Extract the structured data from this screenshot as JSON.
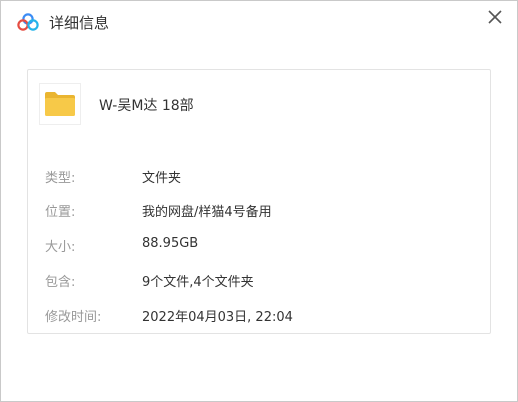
{
  "dialog": {
    "title": "详细信息",
    "logo_icon": "baidu-netdisk-logo",
    "close_icon": "close-icon"
  },
  "file": {
    "icon": "folder-icon",
    "icon_color": "#f7c948",
    "name": "W-吴M达 18部"
  },
  "details": [
    {
      "label": "类型:",
      "value": "文件夹"
    },
    {
      "label": "位置:",
      "value": "我的网盘/样猫4号备用"
    },
    {
      "label": "大小:",
      "value": "88.95GB"
    },
    {
      "label": "包含:",
      "value": "9个文件,4个文件夹"
    },
    {
      "label": "修改时间:",
      "value": "2022年04月03日, 22:04"
    }
  ]
}
